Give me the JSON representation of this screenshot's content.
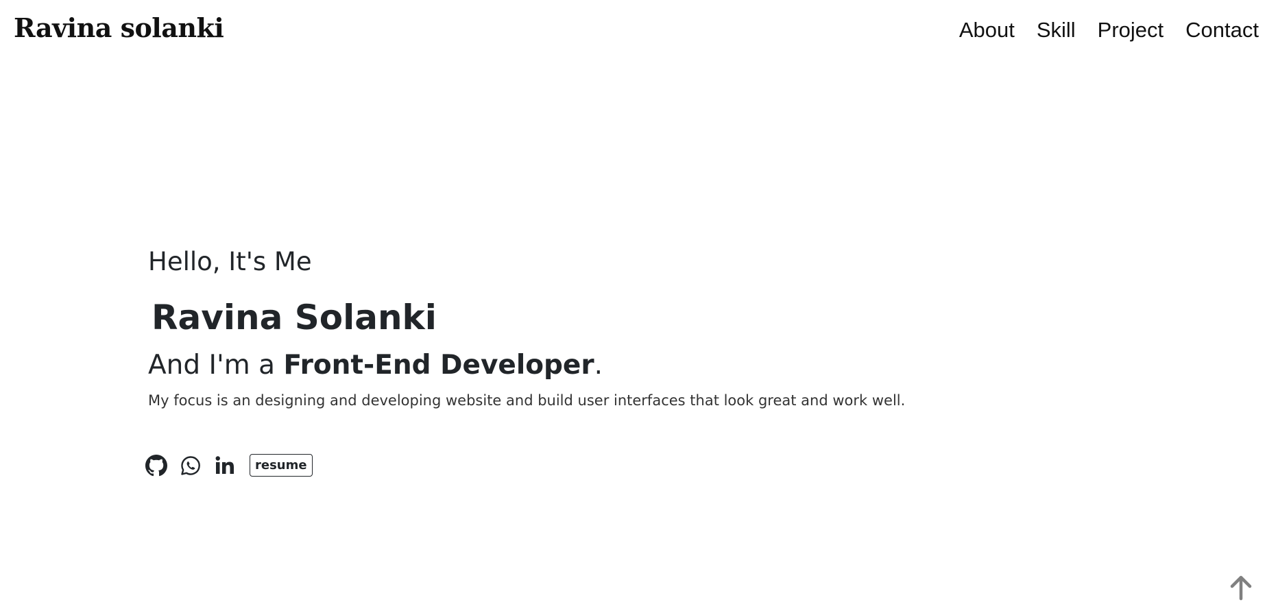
{
  "header": {
    "brand": "Ravina solanki",
    "nav": [
      {
        "label": "About"
      },
      {
        "label": "Skill"
      },
      {
        "label": "Project"
      },
      {
        "label": "Contact"
      }
    ]
  },
  "hero": {
    "greeting": "Hello, It's Me",
    "name": "Ravina Solanki",
    "role_prefix": "And I'm a ",
    "role_title": "Front-End Developer",
    "role_suffix": ".",
    "tagline": "My focus is an designing and developing website and build user interfaces that look great and work well."
  },
  "socials": {
    "icons": [
      "github-icon",
      "whatsapp-icon",
      "linkedin-icon"
    ],
    "resume_label": "resume"
  },
  "scroll_top": {
    "icon": "arrow-up-icon"
  },
  "colors": {
    "text": "#212529",
    "background": "#ffffff",
    "scroll_arrow": "#808080"
  }
}
